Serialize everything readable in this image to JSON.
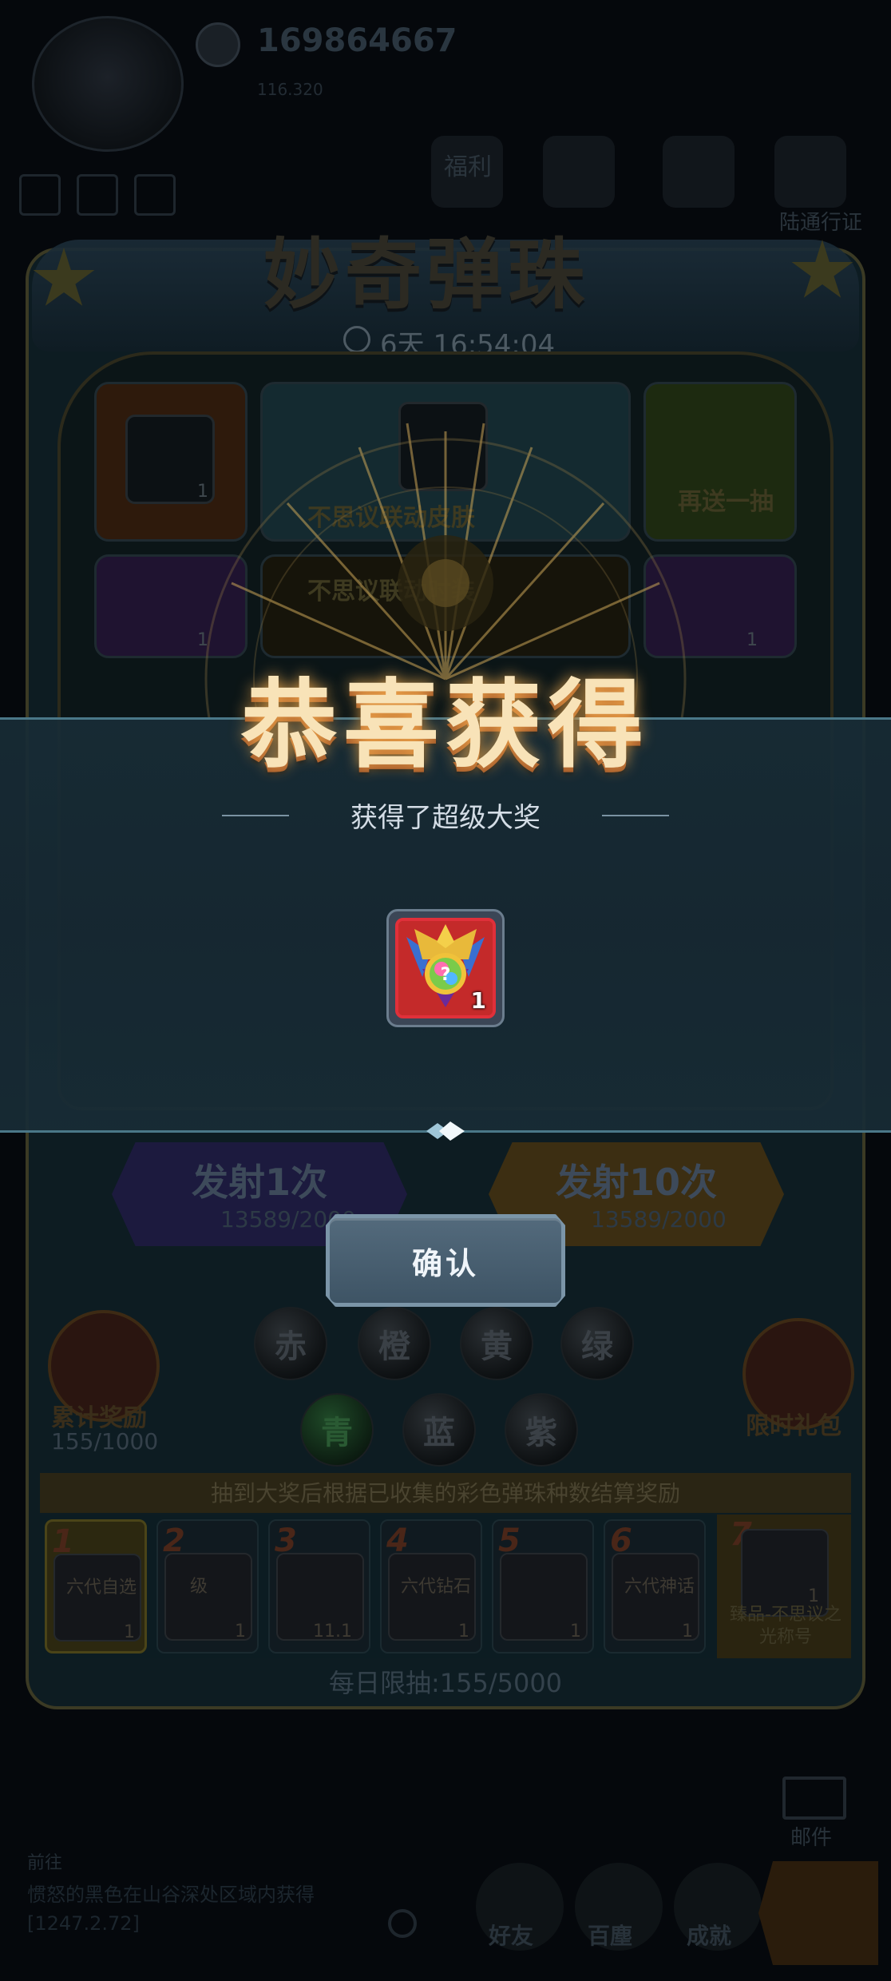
{
  "background": {
    "player_id": "169864667",
    "player_sub": "116.320",
    "top_menu": {
      "welfare_label": "福利",
      "pass_label": "陆通行证"
    },
    "event": {
      "title": "妙奇弹珠",
      "timer": "6天 16:54:04",
      "grid": [
        {
          "label": "",
          "qty": "1"
        },
        {
          "label": "不思议联动皮肤",
          "qty": ""
        },
        {
          "label": "再送一抽",
          "qty": ""
        },
        {
          "label": "",
          "qty": "1"
        },
        {
          "label": "不思议联动时装",
          "qty": ""
        },
        {
          "label": "",
          "qty": "1"
        }
      ],
      "fire_once": {
        "label": "发射1次",
        "count": "13589/2000"
      },
      "fire_ten": {
        "label": "发射10次",
        "count": "13589/2000"
      },
      "balls_row1": [
        "赤",
        "橙",
        "黄",
        "绿"
      ],
      "balls_row2": [
        "青",
        "蓝",
        "紫"
      ],
      "cumulative": {
        "label": "累计奖励",
        "progress": "155/1000"
      },
      "limited_gift": "限时礼包",
      "info_text": "抽到大奖后根据已收集的彩色弹珠种数结算奖励",
      "rewards": [
        {
          "num": "1",
          "tag": "六代自选",
          "qty": "1"
        },
        {
          "num": "2",
          "tag": "级",
          "qty": "1"
        },
        {
          "num": "3",
          "tag": "",
          "qty": "11.1"
        },
        {
          "num": "4",
          "tag": "六代钻石",
          "qty": "1"
        },
        {
          "num": "5",
          "tag": "",
          "qty": "1"
        },
        {
          "num": "6",
          "tag": "六代神话",
          "qty": "1"
        }
      ],
      "final_reward": {
        "num": "7",
        "qty": "1",
        "label": "臻品-不思议之光称号"
      },
      "daily_limit": "每日限抽:155/5000"
    },
    "bottom": {
      "mail_label": "邮件",
      "tip_title": "前往",
      "tip_line1": "惯怒的黑色在山谷深处区域内获得",
      "tip_line2": "[1247.2.72]",
      "nav": [
        "好友",
        "百塵",
        "成就"
      ]
    }
  },
  "modal": {
    "title": "恭喜获得",
    "subtitle": "获得了超级大奖",
    "prize": {
      "quantity": "1",
      "icon": "mystery-medal-icon"
    },
    "confirm_label": "确认"
  },
  "colors": {
    "title_gold": "#f8e3b8",
    "band": "#1b3440",
    "prize_red": "#b21d1d",
    "confirm_bg": "#4a6072"
  }
}
